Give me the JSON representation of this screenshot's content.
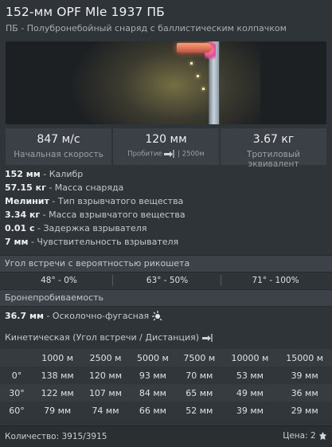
{
  "header": {
    "title": "152-мм OPF Mle 1937 ПБ",
    "subtitle": "ПБ - Полубронебойный снаряд с баллистическим колпачком"
  },
  "stats": {
    "velocity": {
      "value": "847 м/с",
      "label": "Начальная скорость"
    },
    "penetration": {
      "value": "120 мм",
      "label_prefix": "Пробитие",
      "label_suffix": "| 2500м",
      "icon": "penetration-icon"
    },
    "tnt": {
      "value": "3.67 кг",
      "label": "Тротиловый эквивалент"
    }
  },
  "properties": [
    {
      "value": "152 мм",
      "label": " - Калибр"
    },
    {
      "value": "57.15 кг",
      "label": " - Масса снаряда"
    },
    {
      "value": "Мелинит",
      "label": " - Тип взрывчатого вещества"
    },
    {
      "value": "3.34 кг",
      "label": " - Масса взрывчатого вещества"
    },
    {
      "value": "0.01 с",
      "label": " - Задержка взрывателя"
    },
    {
      "value": "7 мм",
      "label": " - Чувствительность взрывателя"
    }
  ],
  "ricochet": {
    "title": "Угол встречи с вероятностью рикошета",
    "values": [
      "48° - 0%",
      "63° - 50%",
      "71° - 100%"
    ]
  },
  "armor": {
    "title": "Бронепробиваемость",
    "he_value": "36.7 мм",
    "he_label": " - Осколочно-фугасная",
    "he_icon": "fragmentation-icon"
  },
  "kinetic": {
    "title": "Кинетическая (Угол встречи / Дистанция)",
    "icon": "penetration-icon",
    "columns": [
      "1000 м",
      "2500 м",
      "5000 м",
      "7500 м",
      "10000 м",
      "15000 м"
    ],
    "rows": [
      {
        "angle": "0°",
        "values": [
          "138 мм",
          "120 мм",
          "93 мм",
          "70 мм",
          "53 мм",
          "39 мм"
        ]
      },
      {
        "angle": "30°",
        "values": [
          "122 мм",
          "107 мм",
          "84 мм",
          "65 мм",
          "49 мм",
          "36 мм"
        ]
      },
      {
        "angle": "60°",
        "values": [
          "79 мм",
          "74 мм",
          "66 мм",
          "52 мм",
          "39 мм",
          "29 мм"
        ]
      }
    ]
  },
  "footer": {
    "quantity": "Количество: 3915/3915",
    "price_label": "Цена: 2",
    "price_icon": "silver-lion-icon"
  }
}
